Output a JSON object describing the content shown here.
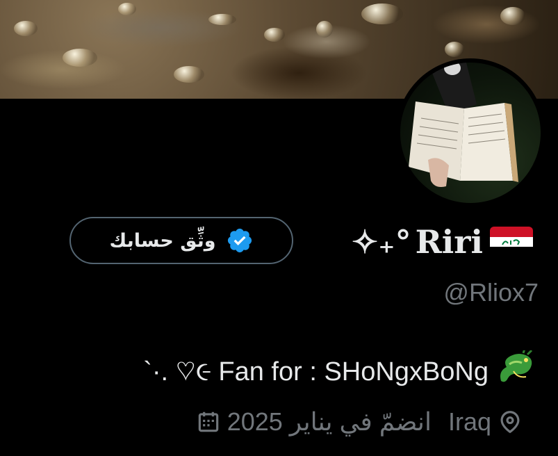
{
  "profile": {
    "display_name": "Riri",
    "name_decoration": "✧₊°",
    "handle": "@Rliox7",
    "verify_button_label": "وثِّق حسابك",
    "bio_text": "Fan for : SHoNgxBoNg",
    "bio_prefix": "`·. ♡︎૯",
    "location": "Iraq",
    "joined": "انضمّ في يناير 2025"
  },
  "icons": {
    "flag": "iraq-flag",
    "verified": "verified-badge-icon",
    "dragon": "dragon-emoji",
    "location": "location-pin-icon",
    "calendar": "calendar-icon"
  },
  "colors": {
    "background": "#000000",
    "primary_text": "#e7e9ea",
    "secondary_text": "#71767b",
    "verified_blue": "#1d9bf0",
    "button_border": "#536471"
  }
}
